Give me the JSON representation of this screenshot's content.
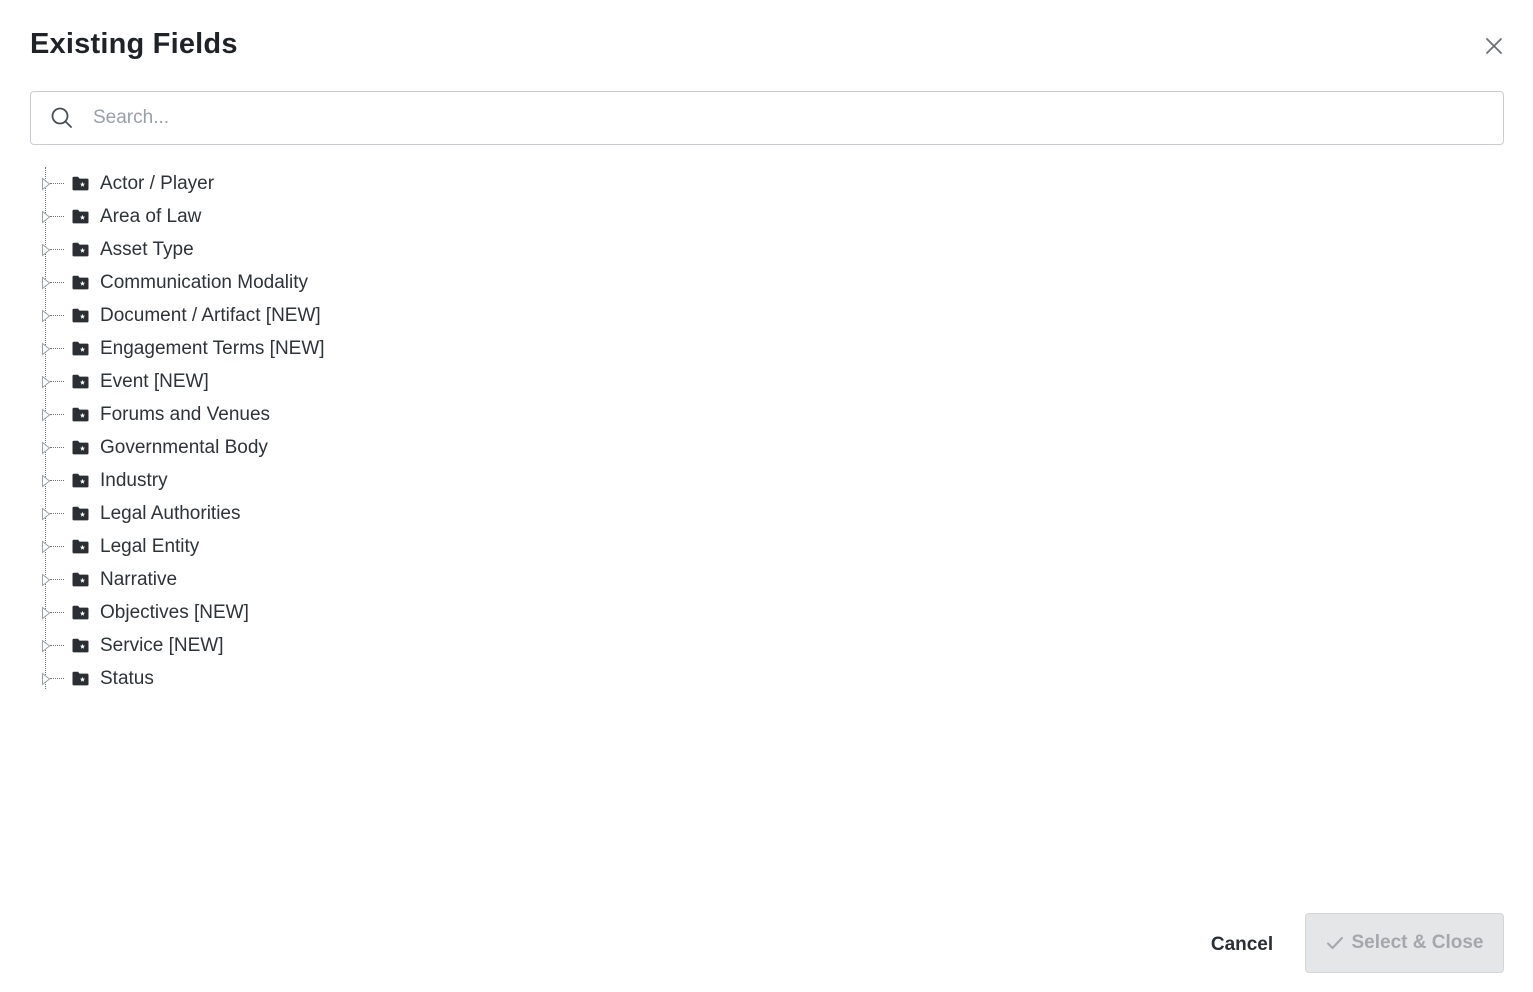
{
  "dialog": {
    "title": "Existing Fields",
    "close_icon": "close-icon"
  },
  "search": {
    "placeholder": "Search...",
    "value": "",
    "icon": "search-icon"
  },
  "tree": {
    "folder_icon": "folder-star-icon",
    "toggle_icon": "caret-right-icon",
    "items": [
      {
        "label": "Actor / Player"
      },
      {
        "label": "Area of Law"
      },
      {
        "label": "Asset Type"
      },
      {
        "label": "Communication Modality"
      },
      {
        "label": "Document / Artifact [NEW]"
      },
      {
        "label": "Engagement Terms [NEW]"
      },
      {
        "label": "Event [NEW]"
      },
      {
        "label": "Forums and Venues"
      },
      {
        "label": "Governmental Body"
      },
      {
        "label": "Industry"
      },
      {
        "label": "Legal Authorities"
      },
      {
        "label": "Legal Entity"
      },
      {
        "label": "Narrative"
      },
      {
        "label": "Objectives [NEW]"
      },
      {
        "label": "Service [NEW]"
      },
      {
        "label": "Status"
      }
    ]
  },
  "footer": {
    "cancel_label": "Cancel",
    "select_label": "Select & Close",
    "select_disabled": true,
    "check_icon": "check-icon"
  },
  "colors": {
    "title_text": "#1f2328",
    "folder_fill": "#2b2f33",
    "disabled_button_bg": "#e5e6e7",
    "disabled_button_text": "#a4a8ac"
  }
}
